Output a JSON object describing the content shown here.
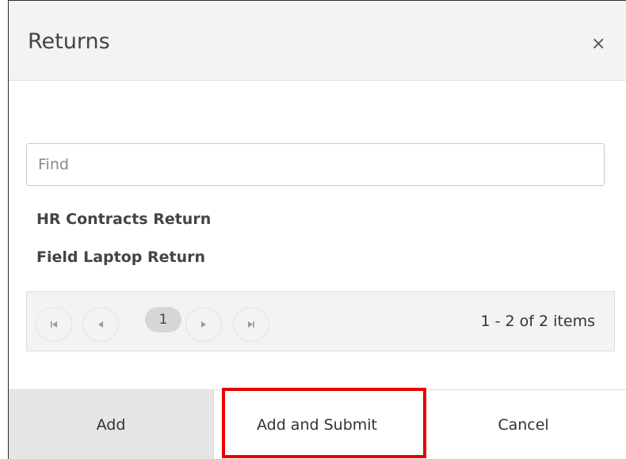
{
  "dialog": {
    "title": "Returns",
    "close_glyph": "×"
  },
  "search": {
    "placeholder": "Find",
    "value": ""
  },
  "list": {
    "items": [
      {
        "label": "HR Contracts Return"
      },
      {
        "label": "Field Laptop Return"
      }
    ]
  },
  "pager": {
    "current_page": "1",
    "info": "1 - 2 of 2 items",
    "icons": [
      "first-page-icon",
      "previous-page-icon",
      "next-page-icon",
      "last-page-icon"
    ]
  },
  "footer": {
    "add_label": "Add",
    "add_submit_label": "Add and Submit",
    "cancel_label": "Cancel"
  },
  "colors": {
    "highlight": "#e60000",
    "titlebar_bg": "#f3f3f3",
    "add_bg": "#e6e6e6"
  }
}
